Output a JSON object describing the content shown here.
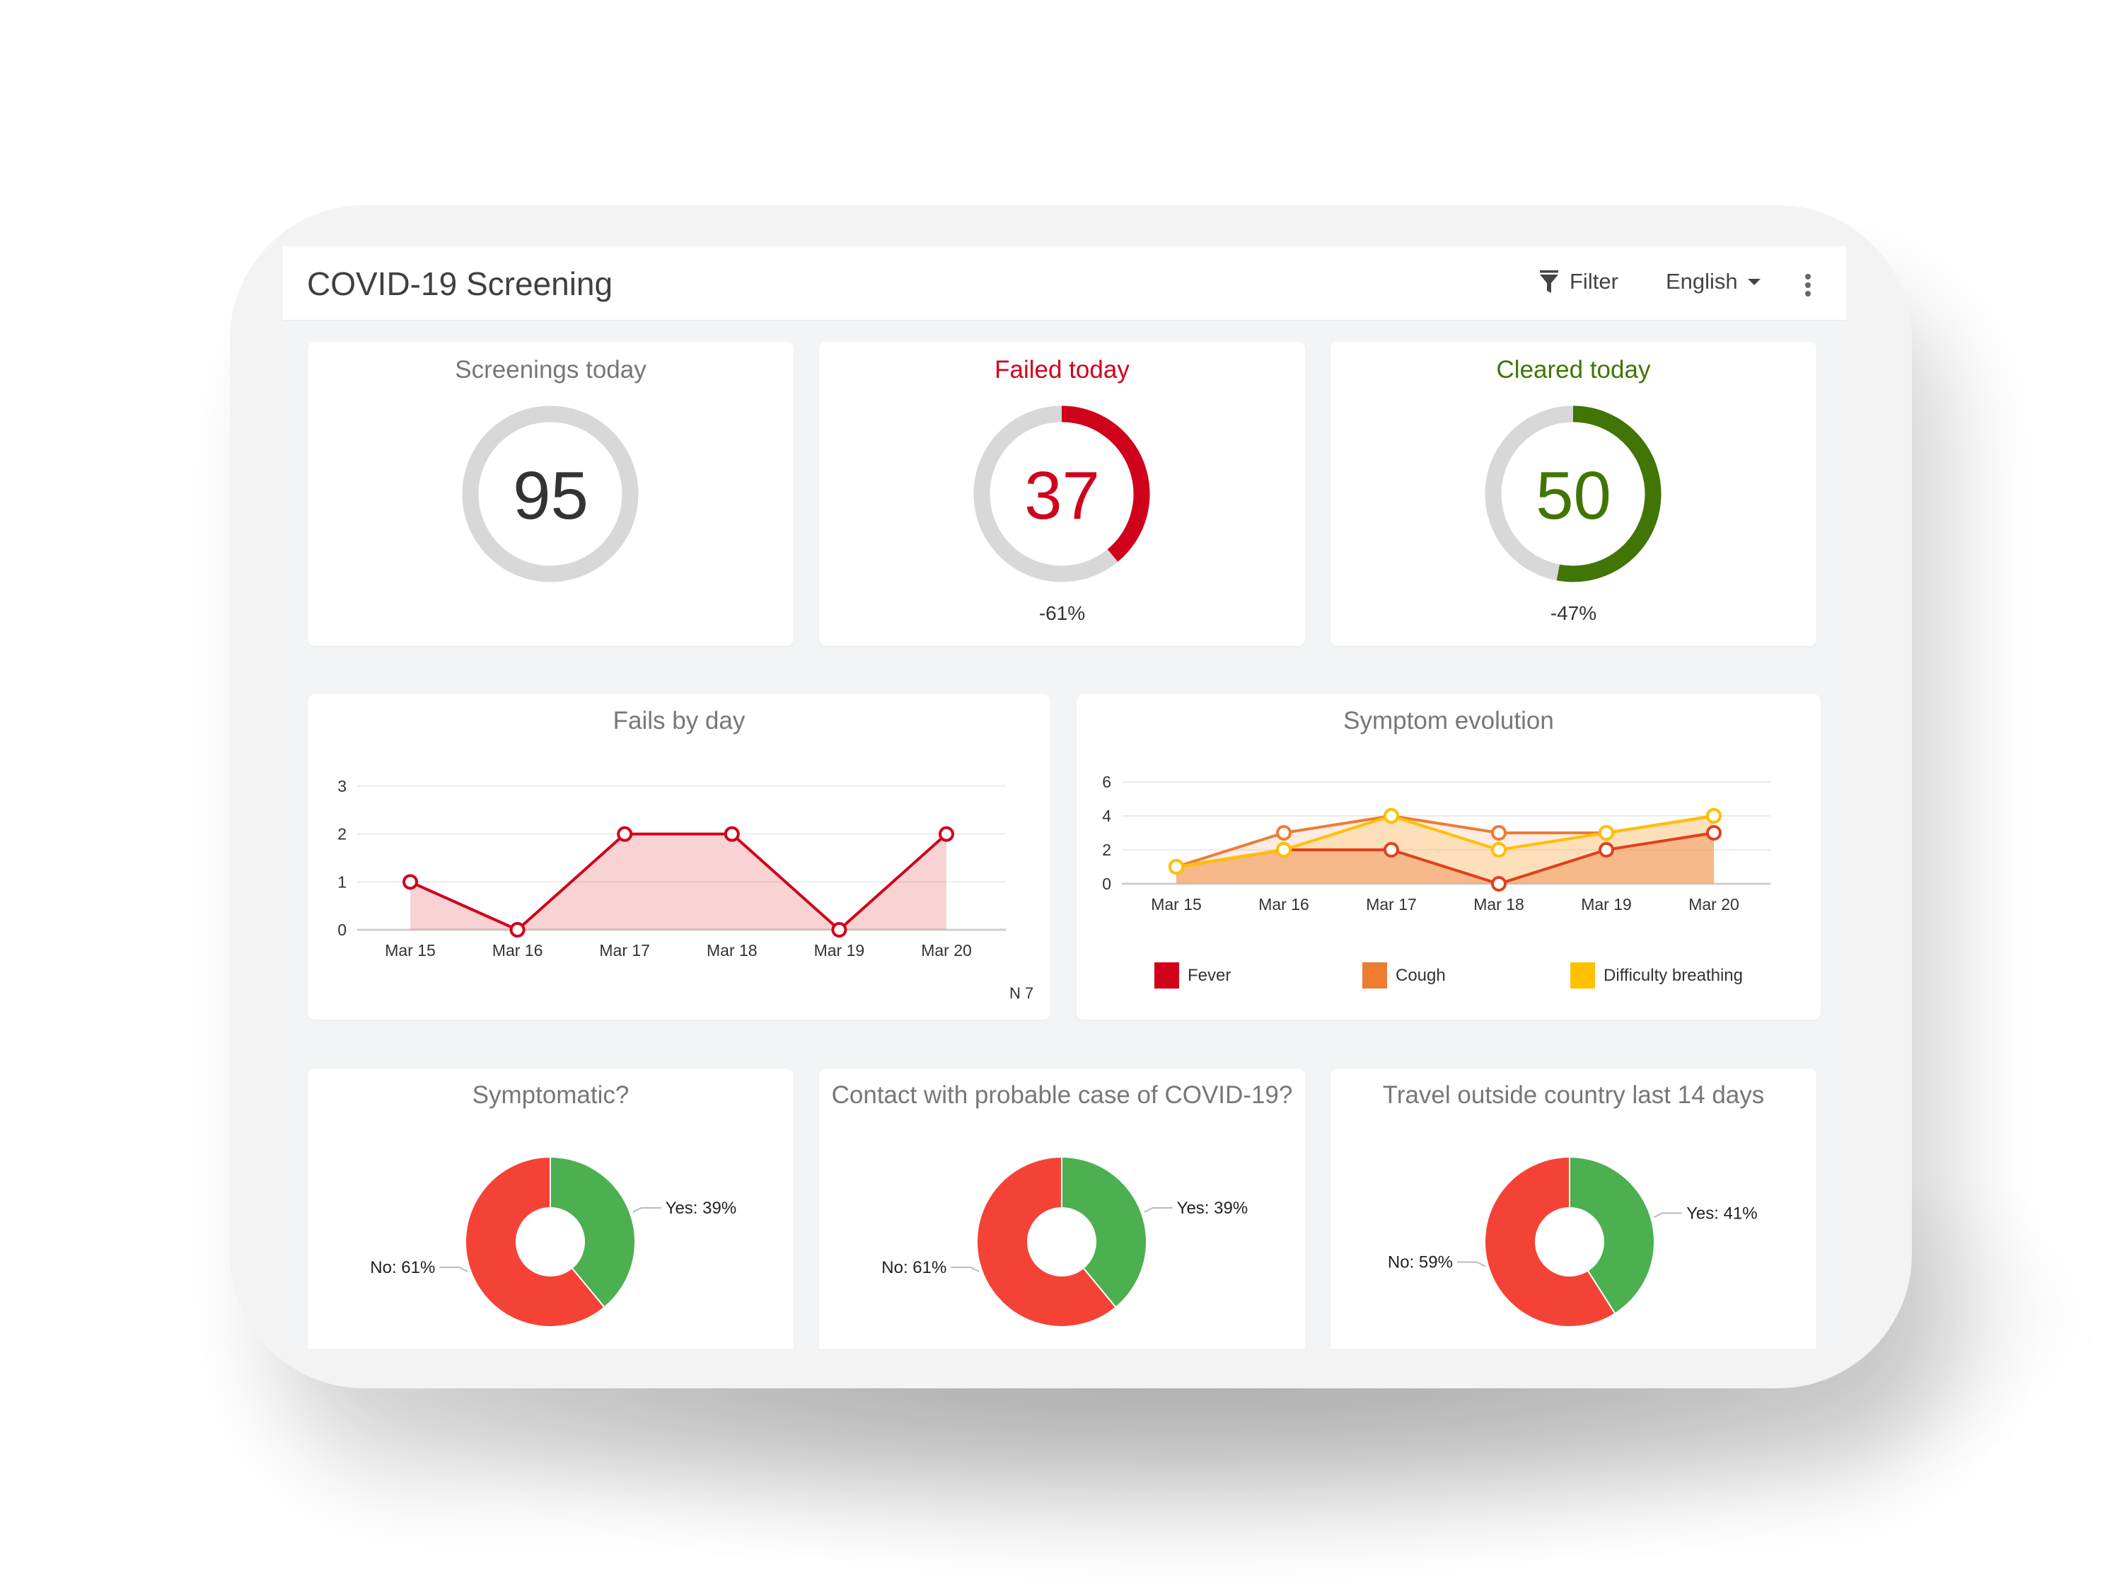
{
  "header": {
    "title": "COVID-19 Screening",
    "filter_label": "Filter",
    "language_label": "English",
    "filter_icon": "filter-funnel-icon",
    "language_icon": "caret-down-icon",
    "more_icon": "more-vertical-icon"
  },
  "colors": {
    "failed": "#d0021b",
    "cleared": "#417505",
    "neutral_ring": "#d8d8d8",
    "fever": "#d0021b",
    "cough": "#ed7d31",
    "difficulty_breathing": "#ffc000",
    "yes": "#4caf50",
    "no": "#f44336"
  },
  "kpis": [
    {
      "title": "Screenings today",
      "value": "95",
      "delta": "",
      "fraction": 0
    },
    {
      "title": "Failed today",
      "value": "37",
      "delta": "-61%",
      "fraction": 0.39
    },
    {
      "title": "Cleared today",
      "value": "50",
      "delta": "-47%",
      "fraction": 0.53
    }
  ],
  "chart_data": [
    {
      "type": "area",
      "title": "Fails by day",
      "categories": [
        "Mar 15",
        "Mar 16",
        "Mar 17",
        "Mar 18",
        "Mar 19",
        "Mar 20"
      ],
      "series": [
        {
          "name": "Fails",
          "values": [
            1,
            0,
            2,
            2,
            0,
            2
          ]
        }
      ],
      "yticks": [
        "0",
        "1",
        "2",
        "3"
      ],
      "ylim": [
        0,
        3
      ],
      "grid": true,
      "footnote": "N 7"
    },
    {
      "type": "area",
      "title": "Symptom evolution",
      "categories": [
        "Mar 15",
        "Mar 16",
        "Mar 17",
        "Mar 18",
        "Mar 19",
        "Mar 20"
      ],
      "series": [
        {
          "name": "Fever",
          "values": [
            1,
            2,
            2,
            0,
            2,
            3
          ]
        },
        {
          "name": "Cough",
          "values": [
            1,
            3,
            4,
            3,
            3,
            4
          ]
        },
        {
          "name": "Difficulty breathing",
          "values": [
            1,
            2,
            4,
            2,
            3,
            4
          ]
        }
      ],
      "yticks": [
        "0",
        "2",
        "4",
        "6"
      ],
      "ylim": [
        0,
        6
      ],
      "grid": true,
      "legend": "bottom"
    },
    {
      "type": "pie",
      "title": "Symptomatic?",
      "slices": [
        {
          "label": "Yes",
          "value": 39,
          "text": "Yes: 39%"
        },
        {
          "label": "No",
          "value": 61,
          "text": "No: 61%"
        }
      ]
    },
    {
      "type": "pie",
      "title": "Contact with probable case of COVID-19?",
      "slices": [
        {
          "label": "Yes",
          "value": 39,
          "text": "Yes: 39%"
        },
        {
          "label": "No",
          "value": 61,
          "text": "No: 61%"
        }
      ]
    },
    {
      "type": "pie",
      "title": "Travel outside country last 14 days",
      "slices": [
        {
          "label": "Yes",
          "value": 41,
          "text": "Yes: 41%"
        },
        {
          "label": "No",
          "value": 59,
          "text": "No: 59%"
        }
      ]
    }
  ]
}
